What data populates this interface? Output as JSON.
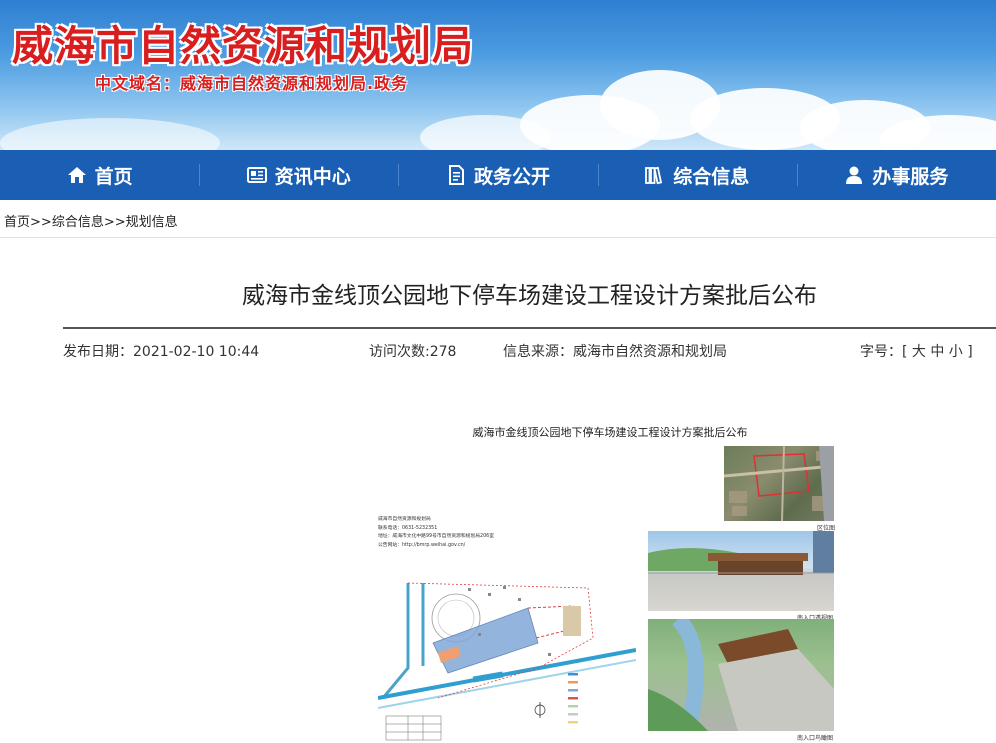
{
  "banner": {
    "title": "威海市自然资源和规划局",
    "domain": "中文域名：威海市自然资源和规划局.政务"
  },
  "nav": {
    "items": [
      {
        "label": "首页",
        "icon": "home-icon"
      },
      {
        "label": "资讯中心",
        "icon": "news-icon"
      },
      {
        "label": "政务公开",
        "icon": "document-icon"
      },
      {
        "label": "综合信息",
        "icon": "books-icon"
      },
      {
        "label": "办事服务",
        "icon": "user-icon"
      }
    ]
  },
  "breadcrumb": {
    "home": "首页",
    "sep1": ">>",
    "level1": "综合信息",
    "sep2": ">>",
    "level2": "规划信息"
  },
  "article": {
    "title": "威海市金线顶公园地下停车场建设工程设计方案批后公布",
    "publish_date": "发布日期：2021-02-10  10:44",
    "views": "访问次数:278",
    "source": "信息来源：威海市自然资源和规划局",
    "font_size_label": "字号：[ 大 中 小 ]"
  },
  "poster": {
    "title": "威海市金线顶公园地下停车场建设工程设计方案批后公布",
    "info_lines": [
      "威海市自然资源和规划局",
      "联系电话：0631-5232351",
      "地址：威海市文化中路99号市自然资源和规划局206室",
      "公告网站：http://bmrp.weihai.gov.cn/"
    ],
    "captions": {
      "location": "区位图",
      "south_entrance_perspective": "南入口透视图",
      "south_entrance_aerial": "南入口鸟瞰图"
    }
  }
}
